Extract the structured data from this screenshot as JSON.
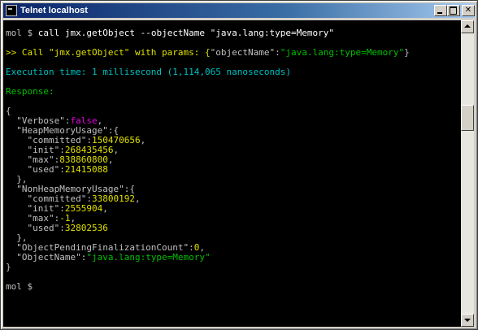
{
  "window": {
    "title": "Telnet localhost",
    "minimize_glyph": "",
    "maximize_glyph": "",
    "close_glyph": "✕",
    "icon": "terminal-icon"
  },
  "terminal": {
    "colors": {
      "background": "#000000",
      "default": "#c0c0c0",
      "green": "#00c000",
      "cyan": "#00c0c0",
      "yellow": "#e0e000",
      "magenta": "#e000e0"
    },
    "lines": [
      {
        "segments": [
          {
            "text": "mol $ ",
            "color": "white"
          },
          {
            "text": "call jmx.getObject --objectName \"java.lang:type=Memory\"",
            "color": "bright"
          }
        ]
      },
      {
        "segments": []
      },
      {
        "segments": [
          {
            "text": ">> Call \"jmx.getObject\" with params: {",
            "color": "yellow"
          },
          {
            "text": "\"objectName\"",
            "color": "white"
          },
          {
            "text": ":",
            "color": "white"
          },
          {
            "text": "\"java.lang:type=Memory\"",
            "color": "green"
          },
          {
            "text": "}",
            "color": "white"
          }
        ]
      },
      {
        "segments": []
      },
      {
        "segments": [
          {
            "text": "Execution time: 1 millisecond (1,114,065 nanoseconds)",
            "color": "cyan"
          }
        ]
      },
      {
        "segments": []
      },
      {
        "segments": [
          {
            "text": "Response:",
            "color": "green"
          }
        ]
      },
      {
        "segments": []
      },
      {
        "segments": [
          {
            "text": "{",
            "color": "white"
          }
        ]
      },
      {
        "segments": [
          {
            "text": "  \"Verbose\":",
            "color": "white"
          },
          {
            "text": "false",
            "color": "magenta"
          },
          {
            "text": ",",
            "color": "white"
          }
        ]
      },
      {
        "segments": [
          {
            "text": "  \"HeapMemoryUsage\":{",
            "color": "white"
          }
        ]
      },
      {
        "segments": [
          {
            "text": "    \"committed\":",
            "color": "white"
          },
          {
            "text": "150470656",
            "color": "yellow"
          },
          {
            "text": ",",
            "color": "white"
          }
        ]
      },
      {
        "segments": [
          {
            "text": "    \"init\":",
            "color": "white"
          },
          {
            "text": "268435456",
            "color": "yellow"
          },
          {
            "text": ",",
            "color": "white"
          }
        ]
      },
      {
        "segments": [
          {
            "text": "    \"max\":",
            "color": "white"
          },
          {
            "text": "838860800",
            "color": "yellow"
          },
          {
            "text": ",",
            "color": "white"
          }
        ]
      },
      {
        "segments": [
          {
            "text": "    \"used\":",
            "color": "white"
          },
          {
            "text": "21415088",
            "color": "yellow"
          }
        ]
      },
      {
        "segments": [
          {
            "text": "  },",
            "color": "white"
          }
        ]
      },
      {
        "segments": [
          {
            "text": "  \"NonHeapMemoryUsage\":{",
            "color": "white"
          }
        ]
      },
      {
        "segments": [
          {
            "text": "    \"committed\":",
            "color": "white"
          },
          {
            "text": "33800192",
            "color": "yellow"
          },
          {
            "text": ",",
            "color": "white"
          }
        ]
      },
      {
        "segments": [
          {
            "text": "    \"init\":",
            "color": "white"
          },
          {
            "text": "2555904",
            "color": "yellow"
          },
          {
            "text": ",",
            "color": "white"
          }
        ]
      },
      {
        "segments": [
          {
            "text": "    \"max\":",
            "color": "white"
          },
          {
            "text": "-1",
            "color": "yellow"
          },
          {
            "text": ",",
            "color": "white"
          }
        ]
      },
      {
        "segments": [
          {
            "text": "    \"used\":",
            "color": "white"
          },
          {
            "text": "32802536",
            "color": "yellow"
          }
        ]
      },
      {
        "segments": [
          {
            "text": "  },",
            "color": "white"
          }
        ]
      },
      {
        "segments": [
          {
            "text": "  \"ObjectPendingFinalizationCount\":",
            "color": "white"
          },
          {
            "text": "0",
            "color": "yellow"
          },
          {
            "text": ",",
            "color": "white"
          }
        ]
      },
      {
        "segments": [
          {
            "text": "  \"ObjectName\":",
            "color": "white"
          },
          {
            "text": "\"java.lang:type=Memory\"",
            "color": "green"
          }
        ]
      },
      {
        "segments": [
          {
            "text": "}",
            "color": "white"
          }
        ]
      },
      {
        "segments": []
      },
      {
        "segments": [
          {
            "text": "mol $",
            "color": "white"
          }
        ]
      }
    ]
  },
  "scrollbar": {
    "position_fraction": 0.3
  }
}
